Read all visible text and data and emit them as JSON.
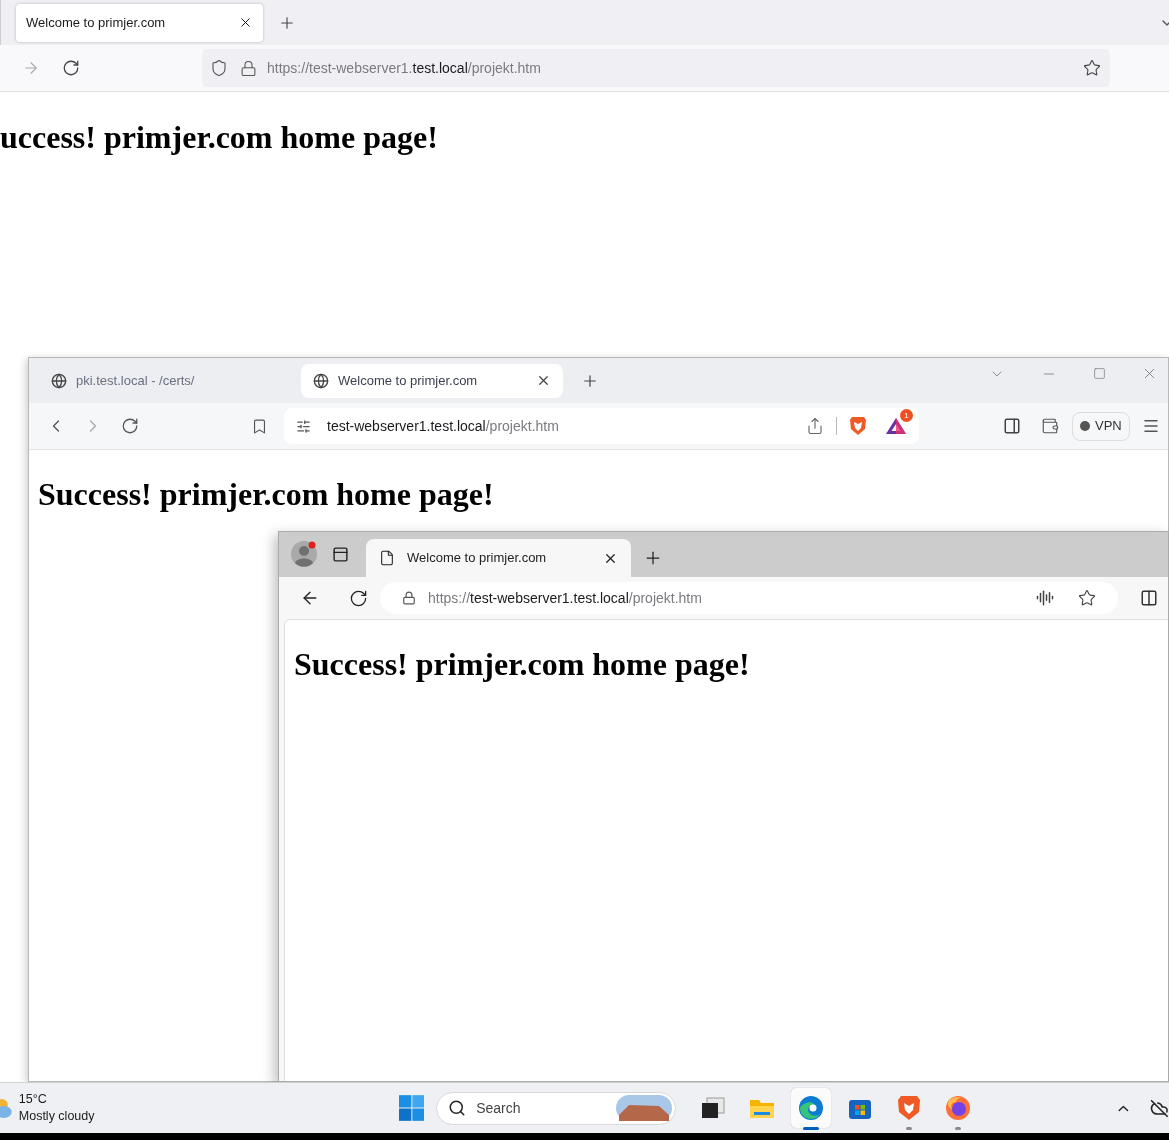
{
  "firefox_window": {
    "tabs": [
      {
        "title": "Welcome to primjer.com",
        "selected": true
      }
    ],
    "address": [
      {
        "text": "https://test-webserver1.",
        "emphasized": false
      },
      {
        "text": "test.local",
        "emphasized": true
      },
      {
        "text": "/projekt.htm",
        "emphasized": false
      }
    ],
    "heading": "uccess! primjer.com home page!"
  },
  "brave_window": {
    "tabs": [
      {
        "title": "pki.test.local - /certs/",
        "selected": false
      },
      {
        "title": "Welcome to primjer.com",
        "selected": true
      }
    ],
    "address": [
      {
        "text": "test-webserver1.test.local",
        "emphasized": true
      },
      {
        "text": "/projekt.htm",
        "emphasized": false
      }
    ],
    "rewards_badge": "1",
    "vpn": "VPN",
    "heading": "Success! primjer.com home page!"
  },
  "edge_window": {
    "tabs": [
      {
        "title": "Welcome to primjer.com",
        "selected": true
      }
    ],
    "address": [
      {
        "text": "https://",
        "emphasized": false
      },
      {
        "text": "test-webserver1.test.local",
        "emphasized": true
      },
      {
        "text": "/projekt.htm",
        "emphasized": false
      }
    ],
    "heading": "Success! primjer.com home page!"
  },
  "taskbar": {
    "weather": {
      "temperature": "15°C",
      "condition": "Mostly cloudy"
    },
    "search": {
      "placeholder": "Search"
    },
    "apps": [
      {
        "kind": "task-view",
        "selected": false,
        "running": false
      },
      {
        "kind": "file-explorer",
        "selected": false,
        "running": false
      },
      {
        "kind": "edge",
        "selected": true,
        "running": true
      },
      {
        "kind": "store",
        "selected": false,
        "running": false
      },
      {
        "kind": "brave",
        "selected": false,
        "running": true
      },
      {
        "kind": "firefox",
        "selected": false,
        "running": true
      }
    ]
  }
}
